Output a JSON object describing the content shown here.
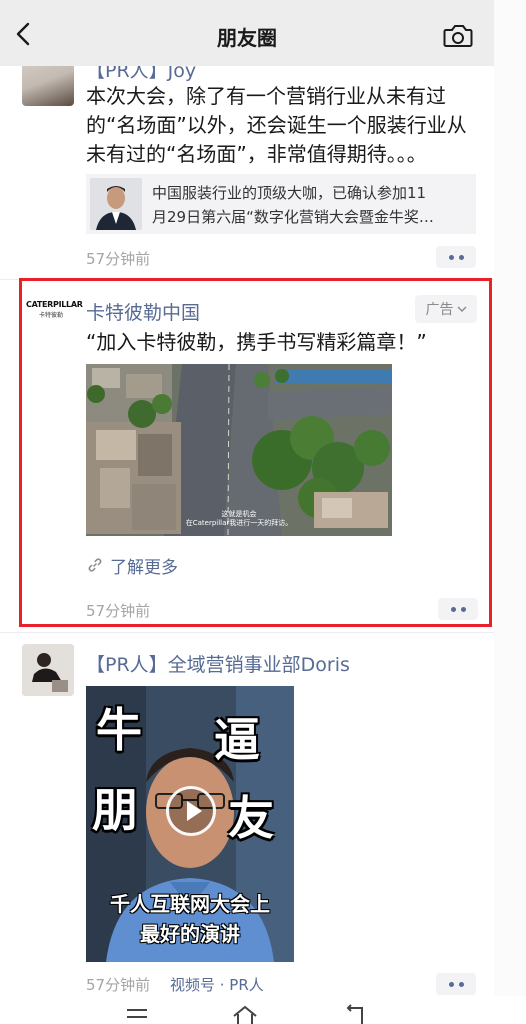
{
  "header": {
    "title": "朋友圈",
    "back_icon": "chevron-left-icon",
    "camera_icon": "camera-icon"
  },
  "posts": [
    {
      "nickname": "【PR人】Joy",
      "text": "本次大会，除了有一个营销行业从未有过的“名场面”以外，还会诞生一个服装行业从未有过的“名场面”，非常值得期待。。。",
      "share": {
        "line1": "中国服装行业的顶级大咖，已确认参加11",
        "line2": "月29日第六届“数字化营销大会暨金牛奖…"
      },
      "time": "57分钟前"
    },
    {
      "logo_line1": "CATERPILLAR",
      "logo_line2": "卡特彼勒",
      "nickname": "卡特彼勒中国",
      "ad_label": "广告",
      "text": "“加入卡特彼勒，携手书写精彩篇章！”",
      "video_caption_line1": "这就是机会",
      "video_caption_line2": "在Caterpillar我进行一天的拜访。",
      "learn_more": "了解更多",
      "time": "57分钟前"
    },
    {
      "nickname": "【PR人】全域营销事业部Doris",
      "video_chars": [
        "牛",
        "逼",
        "朋",
        "友"
      ],
      "video_caption_line1": "千人互联网大会上",
      "video_caption_line2": "最好的演讲",
      "time": "57分钟前",
      "channel": "视频号 · PR人"
    }
  ],
  "colors": {
    "link": "#576b95",
    "header_bg": "#ededed",
    "highlight_border": "#e8212b",
    "time_gray": "#a5a5a5"
  },
  "navbar": {
    "menu_icon": "menu-icon",
    "home_icon": "home-icon",
    "return_icon": "return-icon"
  }
}
